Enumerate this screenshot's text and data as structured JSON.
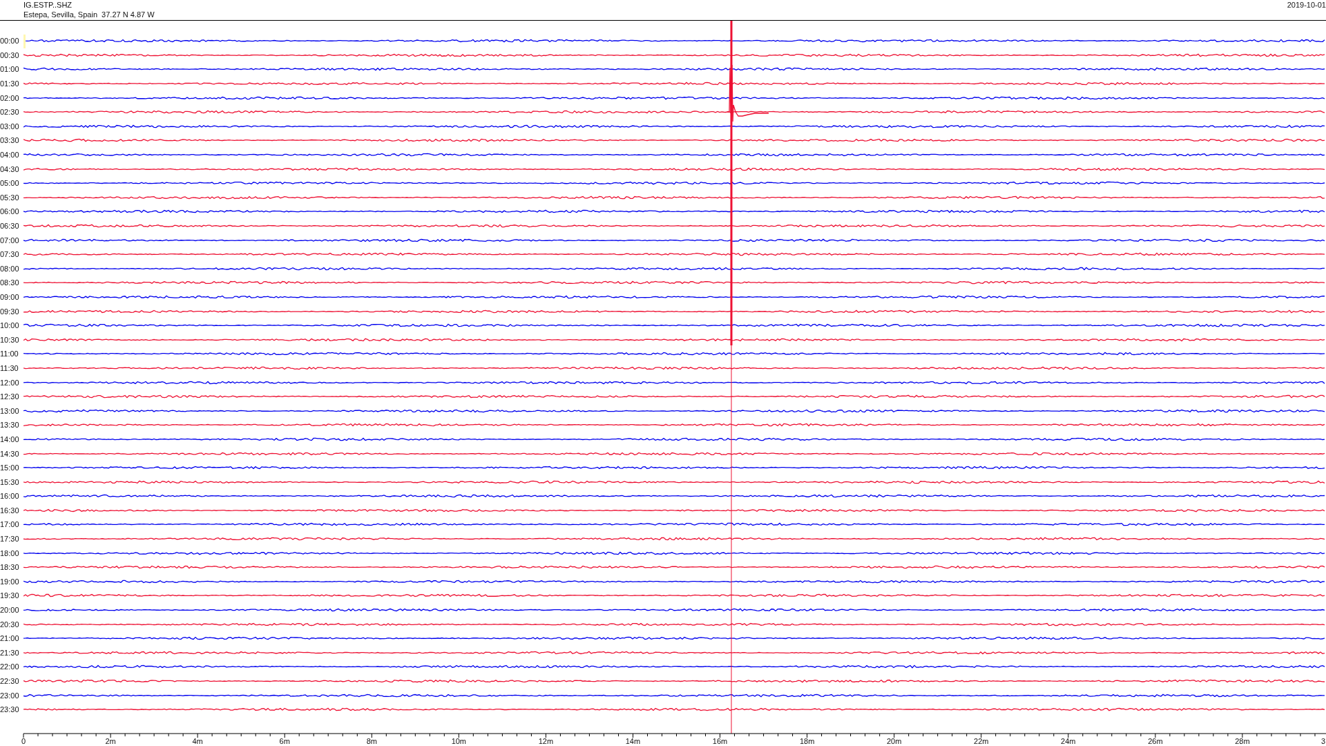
{
  "header": {
    "station": "IG.ESTP..SHZ",
    "location": "Estepa, Sevilla, Spain  37.27 N 4.87 W",
    "date": "2019-10-01"
  },
  "traces": [
    {
      "time": "00:00",
      "color": "#0000ee"
    },
    {
      "time": "00:30",
      "color": "#ee1133"
    },
    {
      "time": "01:00",
      "color": "#0000ee"
    },
    {
      "time": "01:30",
      "color": "#ee1133"
    },
    {
      "time": "02:00",
      "color": "#0000ee"
    },
    {
      "time": "02:30",
      "color": "#ee1133"
    },
    {
      "time": "03:00",
      "color": "#0000ee"
    },
    {
      "time": "03:30",
      "color": "#ee1133"
    },
    {
      "time": "04:00",
      "color": "#0000ee"
    },
    {
      "time": "04:30",
      "color": "#ee1133"
    },
    {
      "time": "05:00",
      "color": "#0000ee"
    },
    {
      "time": "05:30",
      "color": "#ee1133"
    },
    {
      "time": "06:00",
      "color": "#0000ee"
    },
    {
      "time": "06:30",
      "color": "#ee1133"
    },
    {
      "time": "07:00",
      "color": "#0000ee"
    },
    {
      "time": "07:30",
      "color": "#ee1133"
    },
    {
      "time": "08:00",
      "color": "#0000ee"
    },
    {
      "time": "08:30",
      "color": "#ee1133"
    },
    {
      "time": "09:00",
      "color": "#0000ee"
    },
    {
      "time": "09:30",
      "color": "#ee1133"
    },
    {
      "time": "10:00",
      "color": "#0000ee"
    },
    {
      "time": "10:30",
      "color": "#ee1133"
    },
    {
      "time": "11:00",
      "color": "#0000ee"
    },
    {
      "time": "11:30",
      "color": "#ee1133"
    },
    {
      "time": "12:00",
      "color": "#0000ee"
    },
    {
      "time": "12:30",
      "color": "#ee1133"
    },
    {
      "time": "13:00",
      "color": "#0000ee"
    },
    {
      "time": "13:30",
      "color": "#ee1133"
    },
    {
      "time": "14:00",
      "color": "#0000ee"
    },
    {
      "time": "14:30",
      "color": "#ee1133"
    },
    {
      "time": "15:00",
      "color": "#0000ee"
    },
    {
      "time": "15:30",
      "color": "#ee1133"
    },
    {
      "time": "16:00",
      "color": "#0000ee"
    },
    {
      "time": "16:30",
      "color": "#ee1133"
    },
    {
      "time": "17:00",
      "color": "#0000ee"
    },
    {
      "time": "17:30",
      "color": "#ee1133"
    },
    {
      "time": "18:00",
      "color": "#0000ee"
    },
    {
      "time": "18:30",
      "color": "#ee1133"
    },
    {
      "time": "19:00",
      "color": "#0000ee"
    },
    {
      "time": "19:30",
      "color": "#ee1133"
    },
    {
      "time": "20:00",
      "color": "#0000ee"
    },
    {
      "time": "20:30",
      "color": "#ee1133"
    },
    {
      "time": "21:00",
      "color": "#0000ee"
    },
    {
      "time": "21:30",
      "color": "#ee1133"
    },
    {
      "time": "22:00",
      "color": "#0000ee"
    },
    {
      "time": "22:30",
      "color": "#ee1133"
    },
    {
      "time": "23:00",
      "color": "#0000ee"
    },
    {
      "time": "23:30",
      "color": "#ee1133"
    }
  ],
  "axis": {
    "labels": [
      "0",
      "2m",
      "4m",
      "6m",
      "8m",
      "10m",
      "12m",
      "14m",
      "16m",
      "18m",
      "20m",
      "22m",
      "24m",
      "26m",
      "28m",
      "3"
    ]
  }
}
